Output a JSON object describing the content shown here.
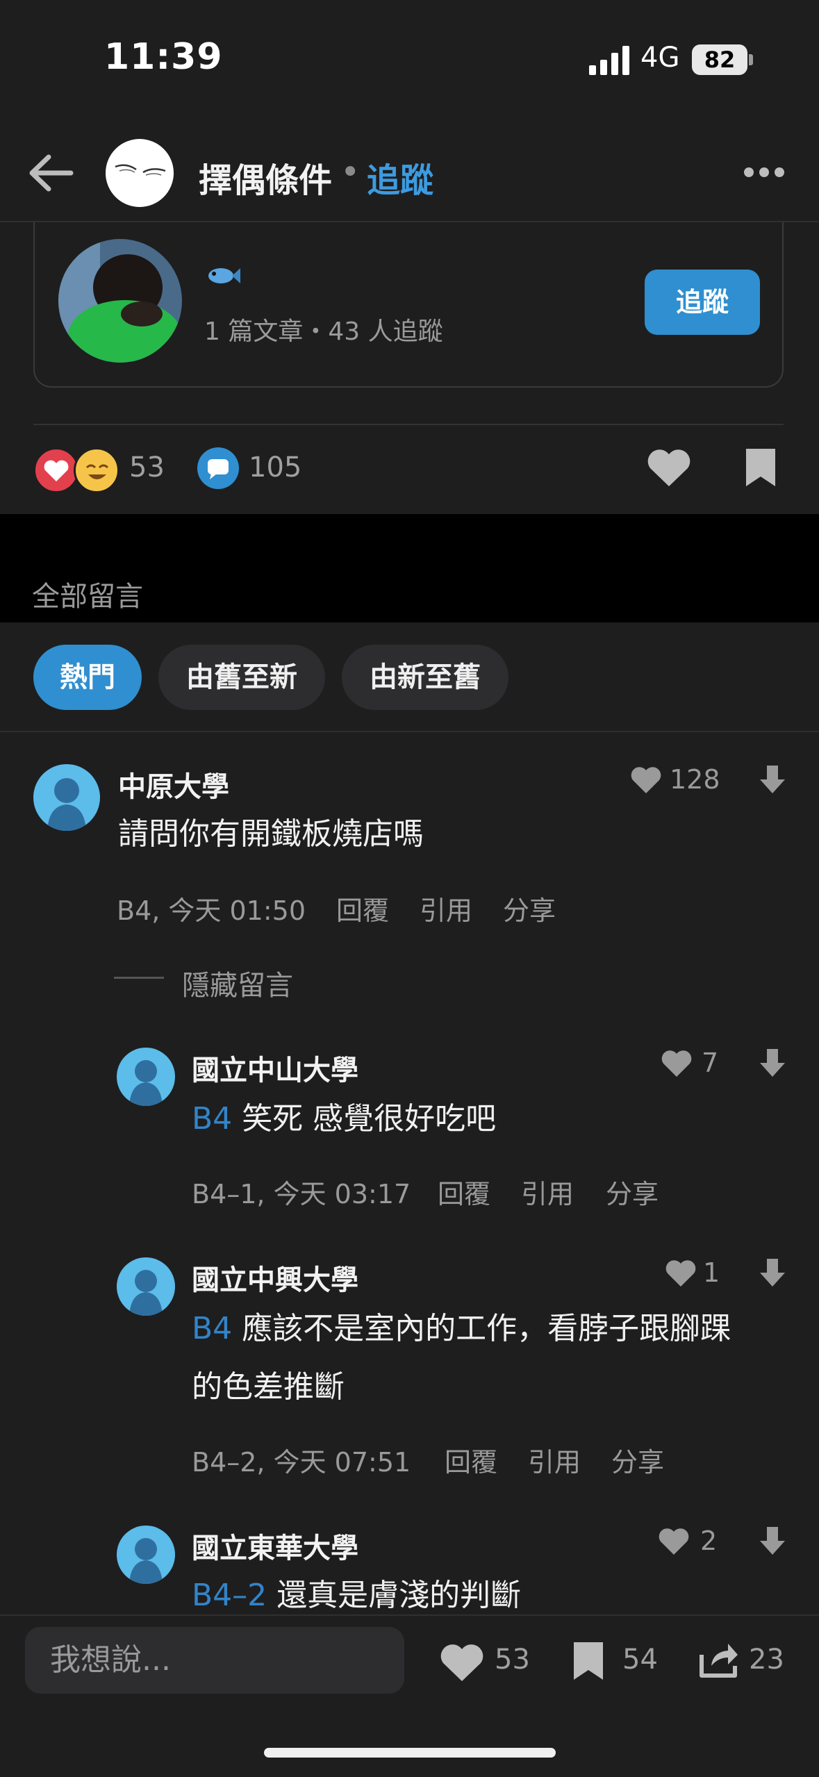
{
  "status_bar": {
    "time": "11:39",
    "network": "4G",
    "battery": "82"
  },
  "header": {
    "title": "擇偶條件",
    "separator": "•",
    "follow_label": "追蹤"
  },
  "author_card": {
    "emoji": "🐟",
    "stats": "1 篇文章・43 人追蹤",
    "follow_label": "追蹤"
  },
  "reactions": {
    "reaction_count": "53",
    "comment_count": "105"
  },
  "comments_section": {
    "label": "全部留言",
    "sort_options": [
      "熱門",
      "由舊至新",
      "由新至舊"
    ],
    "selected_sort": "熱門"
  },
  "comments": [
    {
      "author": "中原大學",
      "tag": "",
      "body": "請問你有開鐵板燒店嗎",
      "meta": "B4, 今天 01:50",
      "likes": "128"
    },
    {
      "author": "國立中山大學",
      "tag": "B4",
      "body": "笑死 感覺很好吃吧",
      "meta": "B4–1, 今天 03:17",
      "likes": "7"
    },
    {
      "author": "國立中興大學",
      "tag": "B4",
      "body": "應該不是室內的工作，看脖子跟腳踝",
      "body2": "的色差推斷",
      "meta": "B4–2, 今天 07:51",
      "likes": "1"
    },
    {
      "author": "國立東華大學",
      "tag": "B4–2",
      "body": "還真是膚淺的判斷",
      "meta": "",
      "likes": "2"
    }
  ],
  "comment_actions": {
    "reply": "回覆",
    "quote": "引用",
    "share": "分享"
  },
  "hidden_comments_label": "隱藏留言",
  "bottom_bar": {
    "placeholder": "我想說...",
    "like_count": "53",
    "bookmark_count": "54",
    "share_count": "23"
  },
  "colors": {
    "accent": "#2f8fd0",
    "background": "#1e1e1f",
    "tag_blue": "#3384c8"
  },
  "icons": [
    "back-arrow-icon",
    "more-icon",
    "fish-icon",
    "heart-icon",
    "bookmark-icon",
    "thumb-down-icon",
    "share-icon"
  ]
}
